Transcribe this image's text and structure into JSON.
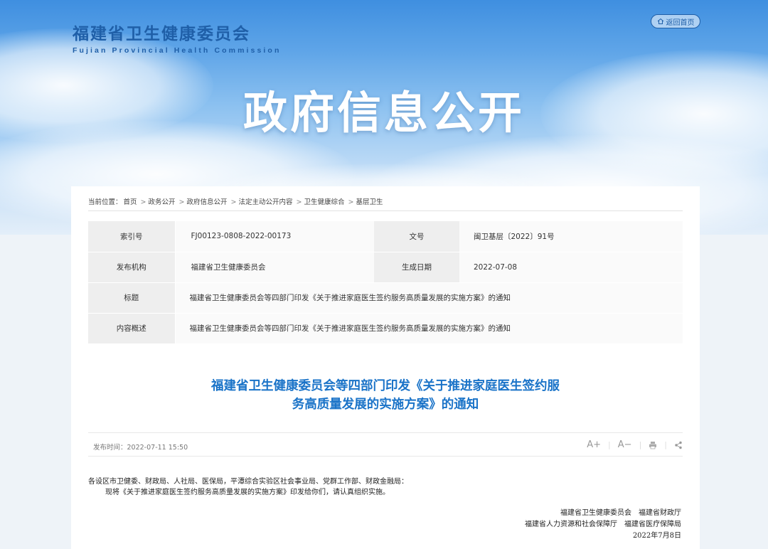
{
  "header": {
    "logo_cn": "福建省卫生健康委员会",
    "logo_en": "Fujian Provincial Health Commission",
    "home_button": "返回首页",
    "hero_title": "政府信息公开"
  },
  "breadcrumb": {
    "prefix": "当前位置：",
    "items": [
      "首页",
      "政务公开",
      "政府信息公开",
      "法定主动公开内容",
      "卫生健康综合",
      "基层卫生"
    ],
    "separator": ">"
  },
  "info": {
    "index_label": "索引号",
    "index_value": "FJ00123-0808-2022-00173",
    "docno_label": "文号",
    "docno_value": "闽卫基层〔2022〕91号",
    "org_label": "发布机构",
    "org_value": "福建省卫生健康委员会",
    "date_label": "生成日期",
    "date_value": "2022-07-08",
    "title_label": "标题",
    "title_value": "福建省卫生健康委员会等四部门印发《关于推进家庭医生签约服务高质量发展的实施方案》的通知",
    "summary_label": "内容概述",
    "summary_value": "福建省卫生健康委员会等四部门印发《关于推进家庭医生签约服务高质量发展的实施方案》的通知"
  },
  "article": {
    "title_line1": "福建省卫生健康委员会等四部门印发《关于推进家庭医生签约服",
    "title_line2": "务高质量发展的实施方案》的通知",
    "pub_time": "发布时间：2022-07-11 15:50",
    "font_increase": "A+",
    "font_decrease": "A−",
    "para1": "各设区市卫健委、财政局、人社局、医保局，平潭综合实验区社会事业局、党群工作部、财政金融局：",
    "para2": "现将《关于推进家庭医生签约服务高质量发展的实施方案》印发给你们，请认真组织实施。",
    "signer1": "福建省卫生健康委员会　福建省财政厅",
    "signer2": "福建省人力资源和社会保障厅　福建省医疗保障局",
    "sign_date": "2022年7月8日"
  },
  "colors": {
    "brand_blue": "#1f5fa8",
    "title_blue": "#1a73c8"
  }
}
